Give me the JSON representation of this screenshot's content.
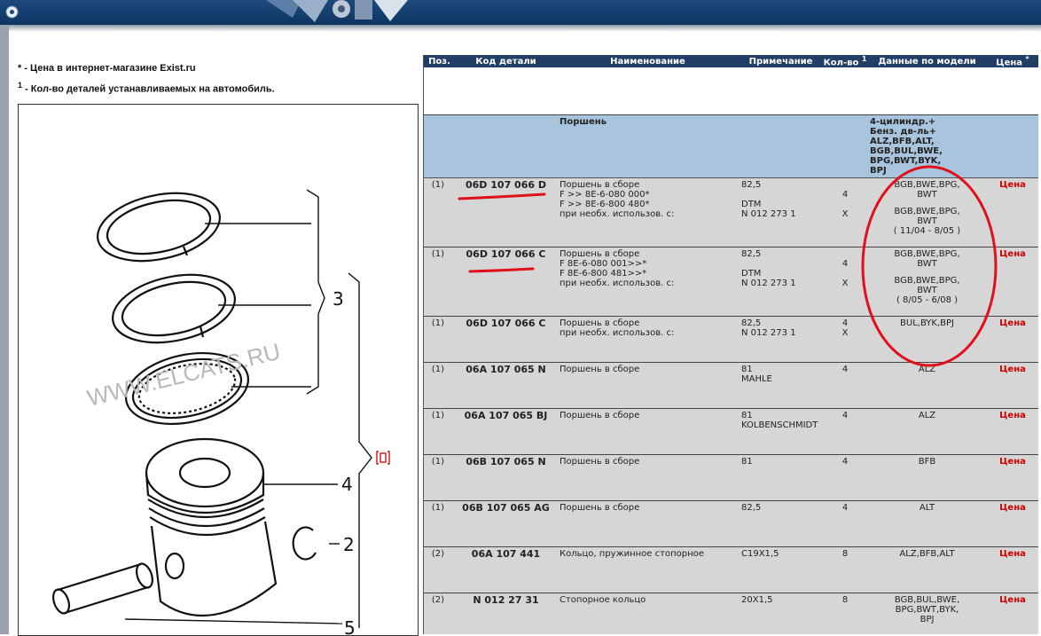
{
  "legend": {
    "line1_marker": "*",
    "line1_text": " - Цена в интернет-магазине Exist.ru",
    "line2_marker": "1",
    "line2_text": " - Кол-во деталей устанавливаемых на автомобиль."
  },
  "diagram": {
    "watermark": "WWW.ELCATS.RU",
    "callouts": [
      "3",
      "4",
      "2",
      "5"
    ]
  },
  "table": {
    "headers": {
      "pos": "Поз.",
      "code": "Код детали",
      "name": "Наименование",
      "note": "Примечание",
      "qty": "Кол-во",
      "qty_sup": "1",
      "model": "Данные по модели",
      "price": "Цена",
      "price_sup": "*"
    },
    "group": {
      "name": "Поршень",
      "model_lines": [
        "4-цилиндр.+",
        "Бенз. дв-ль+",
        "ALZ,BFB,ALT,",
        "BGB,BUL,BWE,",
        "BPG,BWT,BYK,",
        "BPJ"
      ]
    },
    "rows": [
      {
        "pos": "(1)",
        "code": "06D 107 066 D",
        "name_lines": [
          "Поршень в сборе",
          "F >> 8E-6-080 000*",
          "F >> 8E-6-800 480*",
          "при необх. использов. с:"
        ],
        "note_lines": [
          "82,5",
          "",
          "DTM",
          "N 012 273 1"
        ],
        "qty_lines": [
          "",
          "4",
          "",
          "X"
        ],
        "model_lines": [
          "BGB,BWE,BPG,",
          "BWT",
          "BGB,BWE,BPG,",
          "BWT",
          "( 11/04 - 8/05 )"
        ],
        "price": "Цена"
      },
      {
        "pos": "(1)",
        "code": "06D 107 066 C",
        "name_lines": [
          "Поршень в сборе",
          "F 8E-6-080 001>>*",
          "F 8E-6-800 481>>*",
          "при необх. использов. с:"
        ],
        "note_lines": [
          "82,5",
          "",
          "DTM",
          "N 012 273 1"
        ],
        "qty_lines": [
          "",
          "4",
          "",
          "X"
        ],
        "model_lines": [
          "BGB,BWE,BPG,",
          "BWT",
          "BGB,BWE,BPG,",
          "BWT",
          "( 8/05 - 6/08 )"
        ],
        "price": "Цена"
      },
      {
        "pos": "(1)",
        "code": "06D 107 066 C",
        "name_lines": [
          "Поршень в сборе",
          "при необх. использов. с:"
        ],
        "note_lines": [
          "82,5",
          "N 012 273 1"
        ],
        "qty_lines": [
          "4",
          "X"
        ],
        "model_lines": [
          "BUL,BYK,BPJ"
        ],
        "price": "Цена"
      },
      {
        "pos": "(1)",
        "code": "06A 107 065 N",
        "name_lines": [
          "Поршень в сборе"
        ],
        "note_lines": [
          "81",
          "MAHLE"
        ],
        "qty_lines": [
          "4"
        ],
        "model_lines": [
          "ALZ"
        ],
        "price": "Цена"
      },
      {
        "pos": "(1)",
        "code": "06A 107 065 BJ",
        "name_lines": [
          "Поршень в сборе"
        ],
        "note_lines": [
          "81",
          "KOLBENSCHMIDT"
        ],
        "qty_lines": [
          "4"
        ],
        "model_lines": [
          "ALZ"
        ],
        "price": "Цена"
      },
      {
        "pos": "(1)",
        "code": "06B 107 065 N",
        "name_lines": [
          "Поршень в сборе"
        ],
        "note_lines": [
          "81"
        ],
        "qty_lines": [
          "4"
        ],
        "model_lines": [
          "BFB"
        ],
        "price": "Цена"
      },
      {
        "pos": "(1)",
        "code": "06B 107 065 AG",
        "name_lines": [
          "Поршень в сборе"
        ],
        "note_lines": [
          "82,5"
        ],
        "qty_lines": [
          "4"
        ],
        "model_lines": [
          "ALT"
        ],
        "price": "Цена"
      },
      {
        "pos": "(2)",
        "code": "06A 107 441",
        "name_lines": [
          "Кольцо, пружинное стопорное"
        ],
        "note_lines": [
          "C19X1,5"
        ],
        "qty_lines": [
          "8"
        ],
        "model_lines": [
          "ALZ,BFB,ALT"
        ],
        "price": "Цена"
      },
      {
        "pos": "(2)",
        "code": "N 012 27 31",
        "name_lines": [
          "Стопорное кольцо"
        ],
        "note_lines": [
          "20X1,5"
        ],
        "qty_lines": [
          "8"
        ],
        "model_lines": [
          "BGB,BUL,BWE,",
          "BPG,BWT,BYK,",
          "BPJ"
        ],
        "price": "Цена"
      }
    ]
  },
  "colors": {
    "header_bg": "#213e66",
    "group_bg": "#a9c4dd",
    "row_bg": "#d6d6d6",
    "price_red": "#cc0000",
    "annotation_red": "#e0101a"
  }
}
